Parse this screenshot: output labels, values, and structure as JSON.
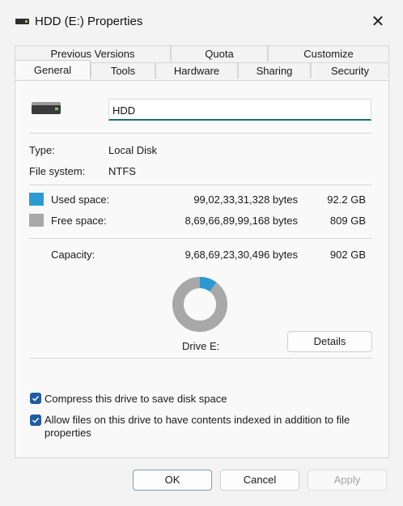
{
  "window": {
    "title": "HDD (E:) Properties",
    "close_glyph": "✕"
  },
  "tabs_top": [
    "Previous Versions",
    "Quota",
    "Customize"
  ],
  "tabs_bottom": [
    "General",
    "Tools",
    "Hardware",
    "Sharing",
    "Security"
  ],
  "active_tab": "General",
  "drive": {
    "icon": "hard-drive-icon",
    "name_value": "HDD"
  },
  "info": {
    "type_label": "Type:",
    "type_value": "Local Disk",
    "fs_label": "File system:",
    "fs_value": "NTFS"
  },
  "space": {
    "used_label": "Used space:",
    "used_bytes": "99,02,33,31,328 bytes",
    "used_short": "92.2 GB",
    "free_label": "Free space:",
    "free_bytes": "8,69,66,89,99,168 bytes",
    "free_short": "809 GB",
    "capacity_label": "Capacity:",
    "capacity_bytes": "9,68,69,23,30,496 bytes",
    "capacity_short": "902 GB",
    "used_color": "#2b9ad2",
    "free_color": "#a8a8a8",
    "used_fraction": 0.1022
  },
  "drive_label": "Drive E:",
  "details_button": "Details",
  "options": {
    "compress_label": "Compress this drive to save disk space",
    "compress_checked": true,
    "index_label_line1": "Allow files on this drive to have contents indexed in addition to file",
    "index_label_line2": "properties",
    "index_checked": true
  },
  "buttons": {
    "ok": "OK",
    "cancel": "Cancel",
    "apply": "Apply"
  }
}
